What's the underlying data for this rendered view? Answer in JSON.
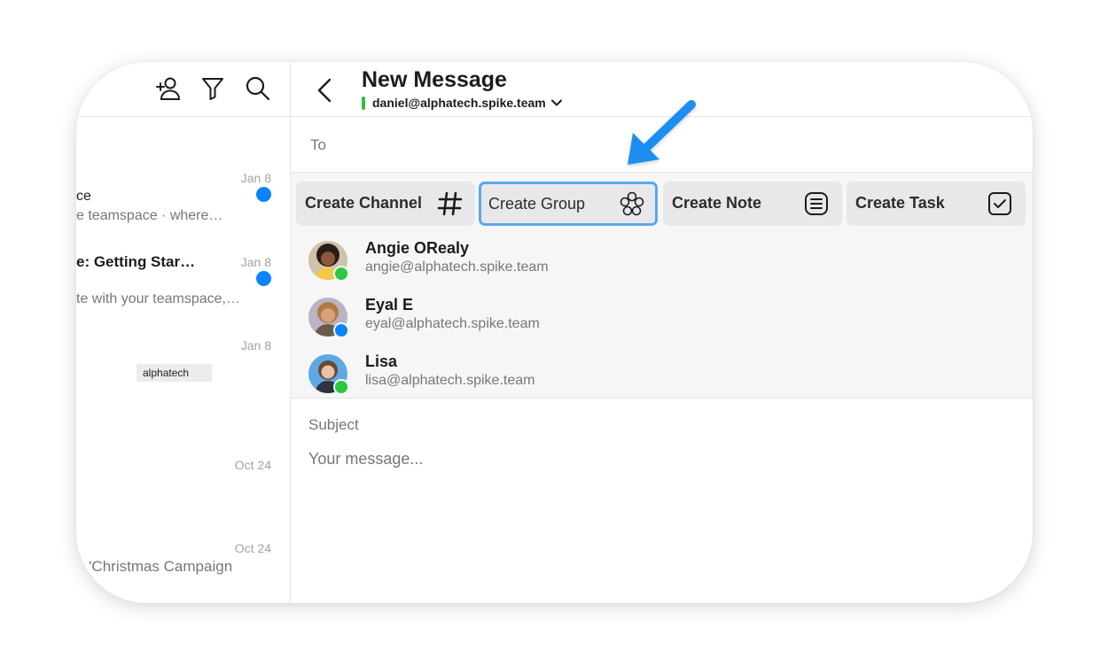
{
  "sidebar": {
    "icons": [
      "add-contact-icon",
      "filter-icon",
      "search-icon"
    ],
    "items": [
      {
        "date": "Jan 8",
        "unread": true,
        "title": "ce",
        "preview": "e teamspace · where…"
      },
      {
        "date": "Jan 8",
        "unread": true,
        "title": "e: Getting Star…",
        "preview": "te with your teamspace,…"
      },
      {
        "date": "Jan 8",
        "tag": "alphatech"
      },
      {
        "date": "Oct 24"
      },
      {
        "date": "Oct 24",
        "preview": "o 'Christmas Campaign"
      }
    ]
  },
  "compose": {
    "title": "New Message",
    "account_email": "daniel@alphatech.spike.team",
    "to_label": "To",
    "subject_placeholder": "Subject",
    "message_placeholder": "Your message...",
    "actions": [
      {
        "label": "Create Channel",
        "icon": "hashtag-icon"
      },
      {
        "label": "Create Group",
        "icon": "group-icon",
        "highlighted": true
      },
      {
        "label": "Create Note",
        "icon": "note-icon"
      },
      {
        "label": "Create Task",
        "icon": "task-checkbox-icon"
      }
    ],
    "contacts": [
      {
        "name": "Angie ORealy",
        "email": "angie@alphatech.spike.team",
        "status_color": "#28c840"
      },
      {
        "name": "Eyal E",
        "email": "eyal@alphatech.spike.team",
        "status_color": "#0a84ff"
      },
      {
        "name": "Lisa",
        "email": "lisa@alphatech.spike.team",
        "status_color": "#28c840"
      }
    ]
  },
  "colors": {
    "accent": "#0a84ff",
    "highlight_border": "#5aa7ee",
    "online": "#28c840",
    "arrow": "#1e8ef0"
  }
}
